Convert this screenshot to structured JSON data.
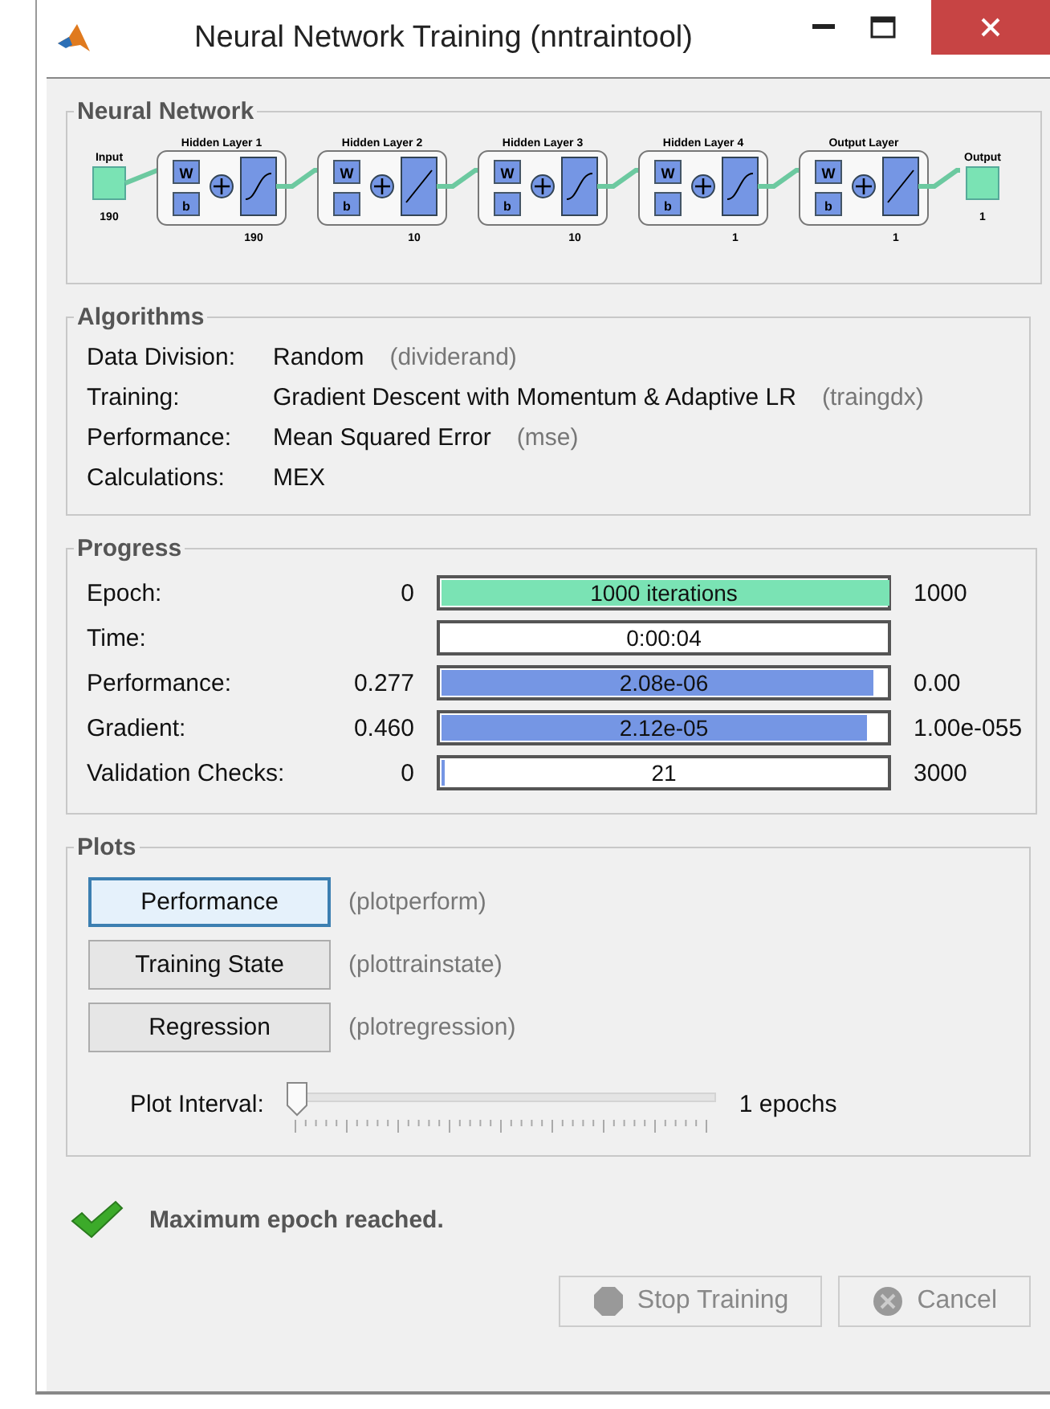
{
  "window": {
    "title": "Neural Network Training (nntraintool)"
  },
  "network": {
    "title": "Neural Network",
    "input": {
      "label": "Input",
      "size": "190"
    },
    "layers": [
      {
        "title": "Hidden Layer 1",
        "weight": "W",
        "bias": "b",
        "kind": "sigmoid",
        "size": "190"
      },
      {
        "title": "Hidden Layer 2",
        "weight": "W",
        "bias": "b",
        "kind": "linear",
        "size": "10"
      },
      {
        "title": "Hidden Layer 3",
        "weight": "W",
        "bias": "b",
        "kind": "sigmoid",
        "size": "10"
      },
      {
        "title": "Hidden Layer 4",
        "weight": "W",
        "bias": "b",
        "kind": "sigmoid",
        "size": "1"
      },
      {
        "title": "Output Layer",
        "weight": "W",
        "bias": "b",
        "kind": "linear",
        "size": "1"
      }
    ],
    "output": {
      "label": "Output",
      "size": "1"
    }
  },
  "algorithms": {
    "title": "Algorithms",
    "rows": [
      {
        "label": "Data Division:",
        "value": "Random",
        "hint": "(dividerand)"
      },
      {
        "label": "Training:",
        "value": "Gradient Descent with Momentum & Adaptive LR",
        "hint": "(traingdx)"
      },
      {
        "label": "Performance:",
        "value": "Mean Squared Error",
        "hint": "(mse)"
      },
      {
        "label": "Calculations:",
        "value": "MEX"
      }
    ]
  },
  "progress": {
    "title": "Progress",
    "rows": [
      {
        "label": "Epoch:",
        "start": "0",
        "bar_text": "1000 iterations",
        "level": 1,
        "color": "#7ae3b4",
        "end": "1000"
      },
      {
        "label": "Time:",
        "bar_text": "0:00:04"
      },
      {
        "label": "Performance:",
        "start": "0.277",
        "bar_text": "2.08e-06",
        "level": 0.965,
        "color": "#7596e4",
        "end": "0.00"
      },
      {
        "label": "Gradient:",
        "start": "0.460",
        "bar_text": "2.12e-05",
        "level": 0.95,
        "color": "#7596e4",
        "end": "1.00e-055"
      },
      {
        "label": "Validation Checks:",
        "start": "0",
        "bar_text": "21",
        "level": 0.007,
        "color": "#7596e4",
        "end": "3000"
      }
    ]
  },
  "plots": {
    "title": "Plots",
    "buttons": [
      {
        "label": "Performance",
        "hint": "(plotperform)",
        "selected": true
      },
      {
        "label": "Training State",
        "hint": "(plottrainstate)",
        "selected": false
      },
      {
        "label": "Regression",
        "hint": "(plotregression)",
        "selected": false
      }
    ],
    "interval": {
      "label": "Plot Interval:",
      "level": 0,
      "reading": "1 epochs"
    }
  },
  "status": {
    "message": "Maximum epoch reached."
  },
  "buttons": [
    {
      "label": "Stop Training",
      "kind": "stop",
      "disabled": true
    },
    {
      "label": "Cancel",
      "kind": "cancel",
      "disabled": true
    }
  ]
}
